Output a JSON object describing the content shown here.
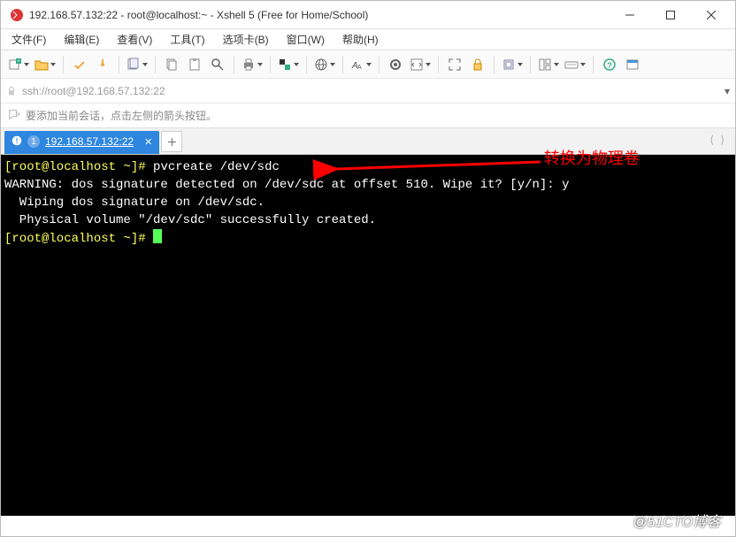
{
  "title": "192.168.57.132:22 - root@localhost:~ - Xshell 5 (Free for Home/School)",
  "menus": {
    "file": "文件(F)",
    "edit": "编辑(E)",
    "view": "查看(V)",
    "tools": "工具(T)",
    "tabs": "选项卡(B)",
    "window": "窗口(W)",
    "help": "帮助(H)"
  },
  "address": "ssh://root@192.168.57.132:22",
  "hint": "要添加当前会话，点击左侧的箭头按钮。",
  "tab": {
    "index": "1",
    "label": "192.168.57.132:22"
  },
  "terminal": {
    "prompt_user": "[root@localhost ~]#",
    "cmd": "pvcreate /dev/sdc",
    "line_warn": "WARNING: dos signature detected on /dev/sdc at offset 510. Wipe it? [y/n]: y",
    "line_wipe": "  Wiping dos signature on /dev/sdc.",
    "line_created": "  Physical volume \"/dev/sdc\" successfully created."
  },
  "annotation_text": "转换为物理卷",
  "watermark": "@51CTO博客"
}
